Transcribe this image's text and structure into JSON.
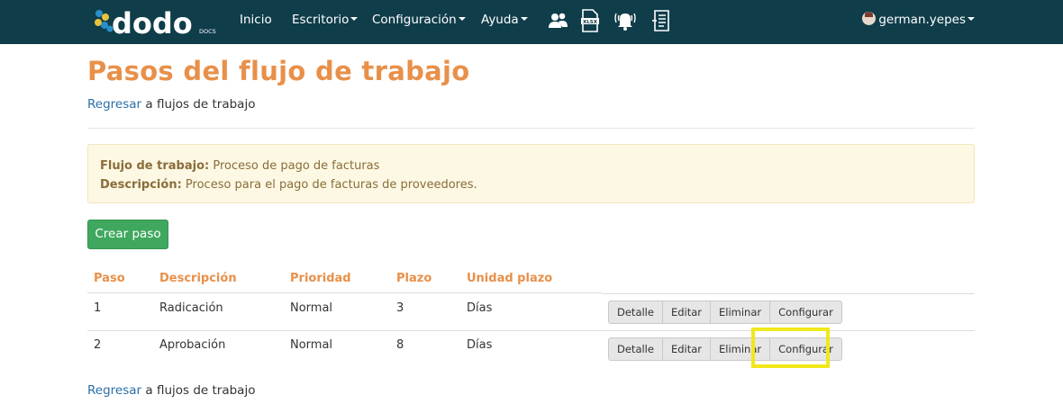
{
  "header": {
    "logo_text": "dodo",
    "logo_sub": "DOCS",
    "nav": [
      {
        "label": "Inicio",
        "dropdown": false
      },
      {
        "label": "Escritorio",
        "dropdown": true
      },
      {
        "label": "Configuración",
        "dropdown": true
      },
      {
        "label": "Ayuda",
        "dropdown": true
      }
    ],
    "icons": [
      "users-icon",
      "xlsx-file-icon",
      "notifications-bell-icon",
      "document-list-icon"
    ],
    "user": {
      "name": "german.yepes"
    }
  },
  "page": {
    "title": "Pasos del flujo de trabajo",
    "back_link": "Regresar",
    "back_text": "a flujos de trabajo"
  },
  "info": {
    "workflow_label": "Flujo de trabajo:",
    "workflow_value": "Proceso de pago de facturas",
    "description_label": "Descripción:",
    "description_value": "Proceso para el pago de facturas de proveedores."
  },
  "create_button": "Crear paso",
  "table": {
    "headers": [
      "Paso",
      "Descripción",
      "Prioridad",
      "Plazo",
      "Unidad plazo"
    ],
    "rows": [
      {
        "paso": "1",
        "descripcion": "Radicación",
        "prioridad": "Normal",
        "plazo": "3",
        "unidad": "Días"
      },
      {
        "paso": "2",
        "descripcion": "Aprobación",
        "prioridad": "Normal",
        "plazo": "8",
        "unidad": "Días"
      }
    ],
    "actions": [
      "Detalle",
      "Editar",
      "Eliminar",
      "Configurar"
    ]
  },
  "colors": {
    "navbar": "#0f3d4a",
    "accent_orange": "#e8904a",
    "link_blue": "#2a6fa8",
    "success_green": "#3fa85e",
    "highlight_yellow": "#f0e81a"
  }
}
